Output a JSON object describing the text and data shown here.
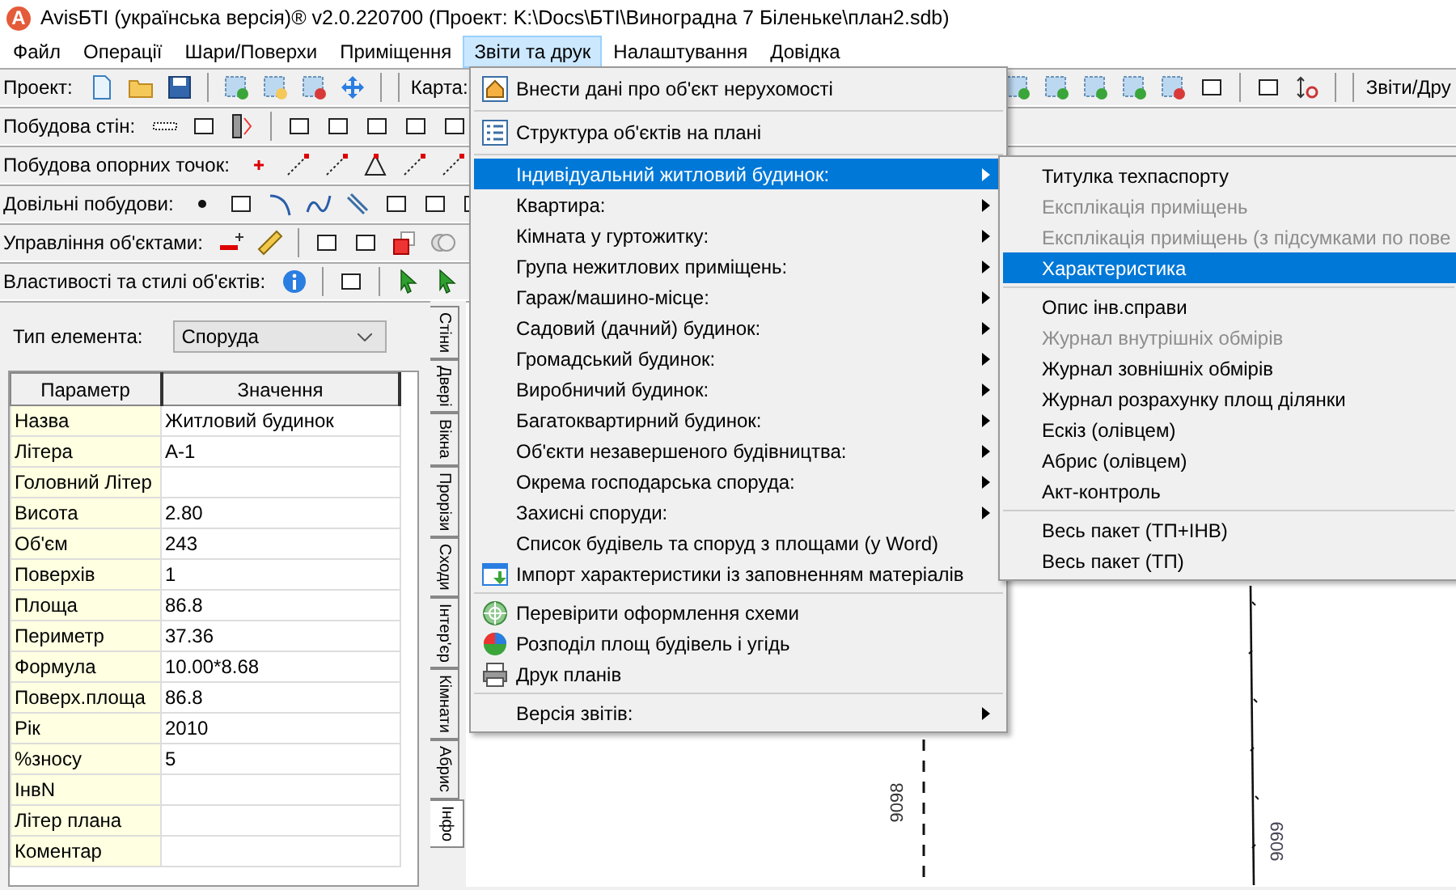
{
  "window": {
    "app_icon_letter": "A",
    "title": "AvisБТІ (українська версія)® v2.0.220700 (Проект: K:\\Docs\\БТІ\\Виноградна 7 Біленьке\\план2.sdb)"
  },
  "menubar": [
    {
      "label": "Файл",
      "selected": false
    },
    {
      "label": "Операції",
      "selected": false
    },
    {
      "label": "Шари/Поверхи",
      "selected": false
    },
    {
      "label": "Приміщення",
      "selected": false
    },
    {
      "label": "Звіти та друк",
      "selected": true
    },
    {
      "label": "Налаштування",
      "selected": false
    },
    {
      "label": "Довідка",
      "selected": false
    }
  ],
  "toolbars": [
    {
      "groups": [
        "Проект:",
        "Карта:",
        "Звіти/Дру"
      ]
    },
    {
      "groups": [
        "Побудова стін:"
      ]
    },
    {
      "groups": [
        "Побудова опорних точок:"
      ]
    },
    {
      "groups": [
        "Довільні побудови:"
      ]
    },
    {
      "groups": [
        "Управління об'єктами:"
      ]
    },
    {
      "groups": [
        "Властивості та стилі об'єктів:"
      ]
    }
  ],
  "properties": {
    "type_label": "Тип елемента:",
    "type_value": "Споруда",
    "columns": [
      "Параметр",
      "Значення"
    ],
    "rows": [
      {
        "parameter": "Назва",
        "value": "Житловий будинок"
      },
      {
        "parameter": "Літера",
        "value": "А-1"
      },
      {
        "parameter": "Головний Літер"
      },
      {
        "parameter": "Висота",
        "value": "2.80"
      },
      {
        "parameter": "Об'єм",
        "value": "243"
      },
      {
        "parameter": "Поверхів",
        "value": "1"
      },
      {
        "parameter": "Площа",
        "value": "86.8"
      },
      {
        "parameter": "Периметр",
        "value": "37.36"
      },
      {
        "parameter": "Формула",
        "value": "10.00*8.68"
      },
      {
        "parameter": "Поверх.площа",
        "value": "86.8"
      },
      {
        "parameter": "Рік",
        "value": "2010"
      },
      {
        "parameter": "%зносу",
        "value": "5"
      },
      {
        "parameter": "ІнвN"
      },
      {
        "parameter": "Літер плана"
      },
      {
        "parameter": "Коментар"
      }
    ]
  },
  "side_tabs": [
    {
      "label": "Стіни",
      "selected": false
    },
    {
      "label": "Двері",
      "selected": false
    },
    {
      "label": "Вікна",
      "selected": false
    },
    {
      "label": "Прорізи",
      "selected": false
    },
    {
      "label": "Сходи",
      "selected": false
    },
    {
      "label": "Інтер'єр",
      "selected": false
    },
    {
      "label": "Кімнати",
      "selected": false
    },
    {
      "label": "Абрис",
      "selected": false
    },
    {
      "label": "Інфо",
      "selected": true
    }
  ],
  "canvas": {
    "labels": [
      "9098",
      "9099"
    ]
  },
  "menu": {
    "groups": [
      [
        {
          "label": "Внести дані про об'єкт нерухомості",
          "selected": false,
          "submenu_arrow": false
        }
      ],
      [
        {
          "label": "Структура об'єктів на плані",
          "selected": false,
          "submenu_arrow": false
        }
      ],
      [
        {
          "label": "Індивідуальний житловий будинок:",
          "selected": true,
          "submenu_arrow": true,
          "submenu": {
            "groups": [
              [
                {
                  "label": "Титулка техпаспорту",
                  "selected": false,
                  "disabled": false
                },
                {
                  "label": "Експлікація приміщень",
                  "selected": false,
                  "disabled": true
                },
                {
                  "label": "Експлікація приміщень (з підсумками по пове",
                  "selected": false,
                  "disabled": true
                },
                {
                  "label": "Характеристика",
                  "selected": true,
                  "disabled": false
                }
              ],
              [
                {
                  "label": "Опис інв.справи",
                  "selected": false,
                  "disabled": false
                },
                {
                  "label": "Журнал внутрішніх обмірів",
                  "selected": false,
                  "disabled": true
                },
                {
                  "label": "Журнал зовнішніх обмірів",
                  "selected": false,
                  "disabled": false
                },
                {
                  "label": "Журнал розрахунку площ ділянки",
                  "selected": false,
                  "disabled": false
                },
                {
                  "label": "Ескіз (олівцем)",
                  "selected": false,
                  "disabled": false
                },
                {
                  "label": "Абрис (олівцем)",
                  "selected": false,
                  "disabled": false
                },
                {
                  "label": "Акт-контроль",
                  "selected": false,
                  "disabled": false
                }
              ],
              [
                {
                  "label": "Весь пакет (ТП+ІНВ)",
                  "selected": false,
                  "disabled": false
                },
                {
                  "label": "Весь пакет (ТП)",
                  "selected": false,
                  "disabled": false
                }
              ]
            ]
          }
        },
        {
          "label": "Квартира:",
          "selected": false,
          "submenu_arrow": true
        },
        {
          "label": "Кімната у гуртожитку:",
          "selected": false,
          "submenu_arrow": true
        },
        {
          "label": "Група нежитлових приміщень:",
          "selected": false,
          "submenu_arrow": true
        },
        {
          "label": "Гараж/машино-місце:",
          "selected": false,
          "submenu_arrow": true
        },
        {
          "label": "Садовий (дачний) будинок:",
          "selected": false,
          "submenu_arrow": true
        },
        {
          "label": "Громадський будинок:",
          "selected": false,
          "submenu_arrow": true
        },
        {
          "label": "Виробничий будинок:",
          "selected": false,
          "submenu_arrow": true
        },
        {
          "label": "Багатоквартирний будинок:",
          "selected": false,
          "submenu_arrow": true
        },
        {
          "label": "Об'єкти незавершеного будівництва:",
          "selected": false,
          "submenu_arrow": true
        },
        {
          "label": "Окрема господарська споруда:",
          "selected": false,
          "submenu_arrow": true
        },
        {
          "label": "Захисні споруди:",
          "selected": false,
          "submenu_arrow": true
        },
        {
          "label": "Список будівель та споруд з площами (у Word)",
          "selected": false,
          "submenu_arrow": false
        },
        {
          "label": "Імпорт характеристики із заповненням матеріалів",
          "selected": false,
          "submenu_arrow": false
        }
      ],
      [
        {
          "label": "Перевірити оформлення схеми",
          "selected": false,
          "submenu_arrow": false
        },
        {
          "label": "Розподіл площ будівель і угідь",
          "selected": false,
          "submenu_arrow": false
        },
        {
          "label": "Друк планів",
          "selected": false,
          "submenu_arrow": false
        }
      ],
      [
        {
          "label": "Версія звітів:",
          "selected": false,
          "submenu_arrow": true
        }
      ]
    ]
  }
}
